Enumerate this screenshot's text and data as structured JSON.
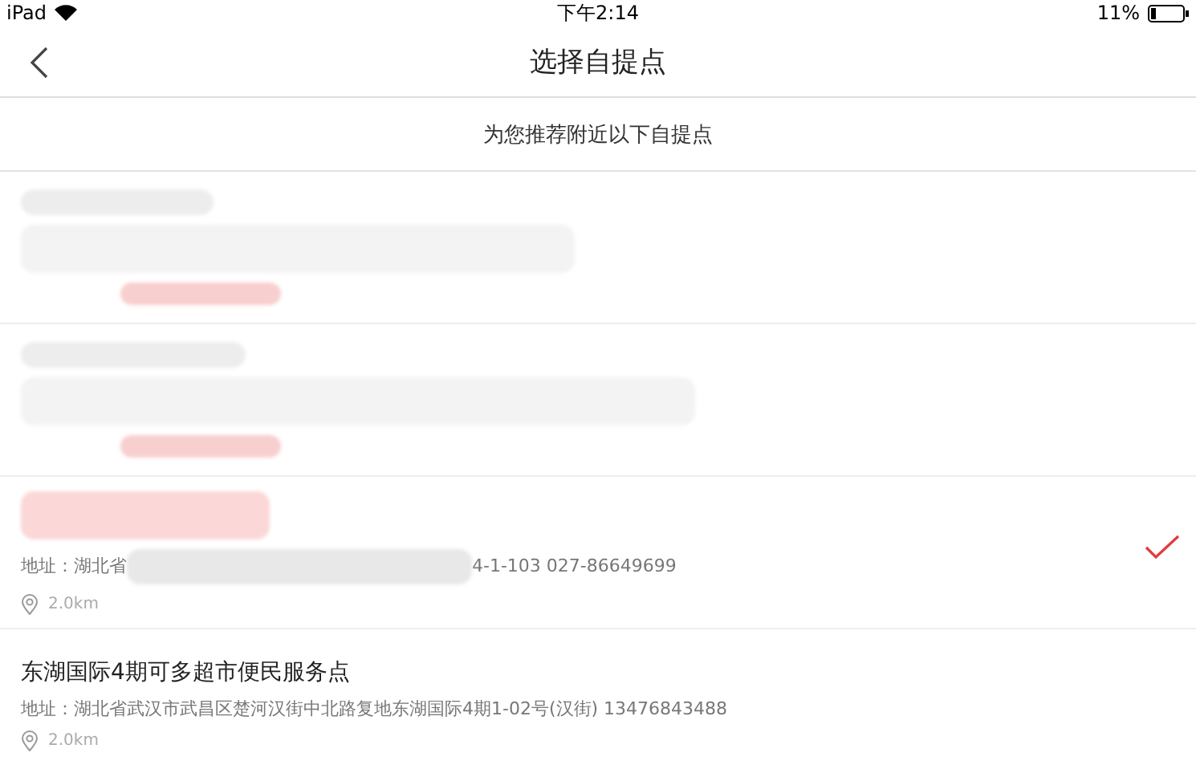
{
  "status_bar": {
    "carrier": "iPad",
    "time": "下午2:14",
    "battery": "11%"
  },
  "nav": {
    "title": "选择自提点"
  },
  "banner": "为您推荐附近以下自提点",
  "stores": [
    {
      "kind": "redacted",
      "selected": false
    },
    {
      "kind": "redacted",
      "selected": false
    },
    {
      "kind": "partial",
      "selected": true,
      "address_start": "地址：湖北省",
      "address_end": "4-1-103 027-86649699",
      "distance": "2.0km"
    },
    {
      "kind": "full",
      "selected": false,
      "name": "东湖国际4期可多超市便民服务点",
      "address": "地址：湖北省武汉市武昌区楚河汉街中北路复地东湖国际4期1-02号(汉街) 13476843488",
      "distance": "2.0km"
    }
  ]
}
